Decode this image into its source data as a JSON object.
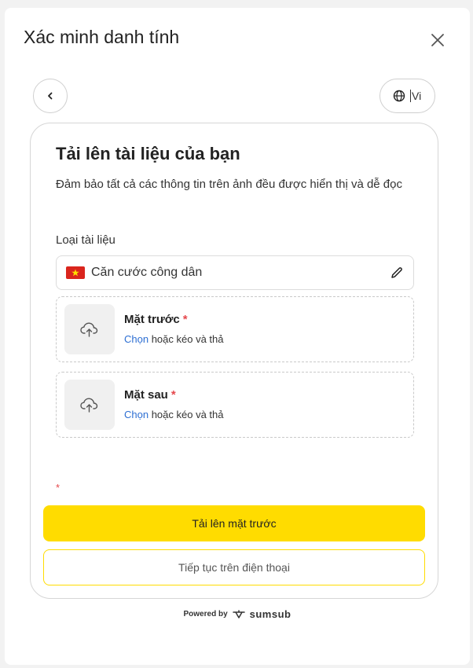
{
  "modal": {
    "title": "Xác minh danh tính",
    "language": "Vi"
  },
  "card": {
    "title": "Tải lên tài liệu của bạn",
    "subtitle": "Đảm bảo tất cả các thông tin trên ảnh đều được hiển thị và dễ đọc",
    "doc_type_label": "Loại tài liệu",
    "doc_type_value": "Căn cước công dân",
    "front": {
      "title": "Mặt trước",
      "required": "*",
      "choose": "Chọn",
      "hint": " hoặc kéo và thả"
    },
    "back": {
      "title": "Mặt sau",
      "required": "*",
      "choose": "Chọn",
      "hint": " hoặc kéo và thả"
    },
    "required_marker": "*",
    "primary_button": "Tải lên mặt trước",
    "secondary_button": "Tiếp tục trên điện thoại"
  },
  "footer": {
    "powered_by": "Powered by",
    "brand": "sumsub"
  },
  "colors": {
    "accent": "#ffdc00",
    "link": "#2d6fd3",
    "required": "#e5484d",
    "flag": "#da251d"
  },
  "icons": [
    "close-icon",
    "chevron-left-icon",
    "globe-icon",
    "vietnam-flag-icon",
    "pencil-icon",
    "cloud-upload-icon",
    "sumsub-logo-icon"
  ]
}
